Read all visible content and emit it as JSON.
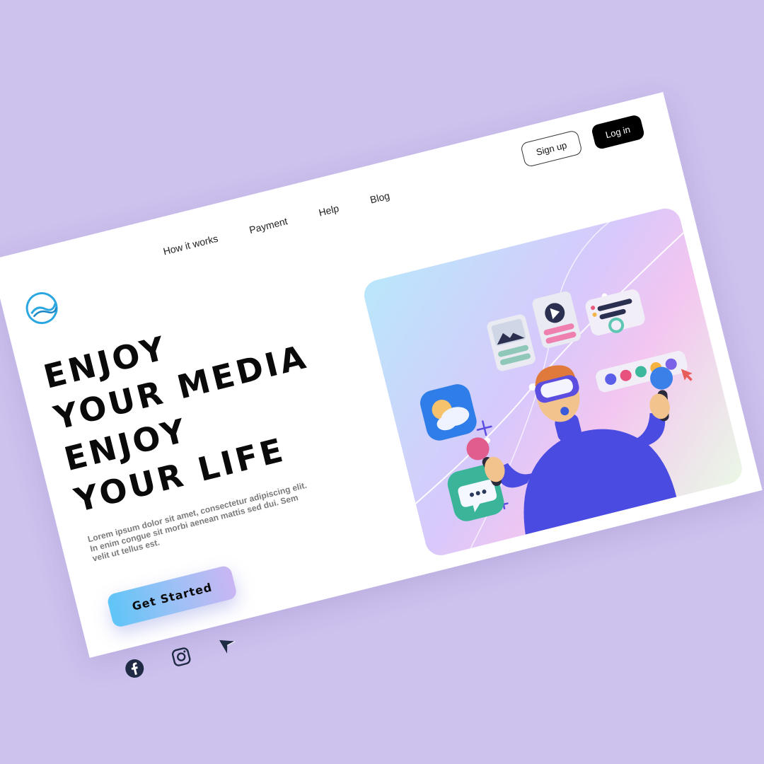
{
  "nav": {
    "items": [
      "How it works",
      "Payment",
      "Help",
      "Blog"
    ]
  },
  "auth": {
    "signup_label": "Sign up",
    "login_label": "Log in"
  },
  "hero": {
    "headline": [
      "ENJOY",
      "YOUR MEDIA",
      "ENJOY",
      "YOUR LIFE"
    ],
    "description": "Lorem ipsum dolor sit amet, consectetur adipiscing elit. In enim congue sit morbi aenean mattis sed dui. Sem velit ut tellus est.",
    "cta_label": "Get Started"
  },
  "icons": {
    "logo": "wave-logo-icon",
    "social": [
      "facebook-icon",
      "instagram-icon",
      "send-icon"
    ]
  },
  "colors": {
    "background": "#cdc1ee",
    "card": "#ffffff",
    "accent_blue": "#5fc5f7",
    "accent_purple": "#5b4de0",
    "dark_button": "#000000"
  }
}
